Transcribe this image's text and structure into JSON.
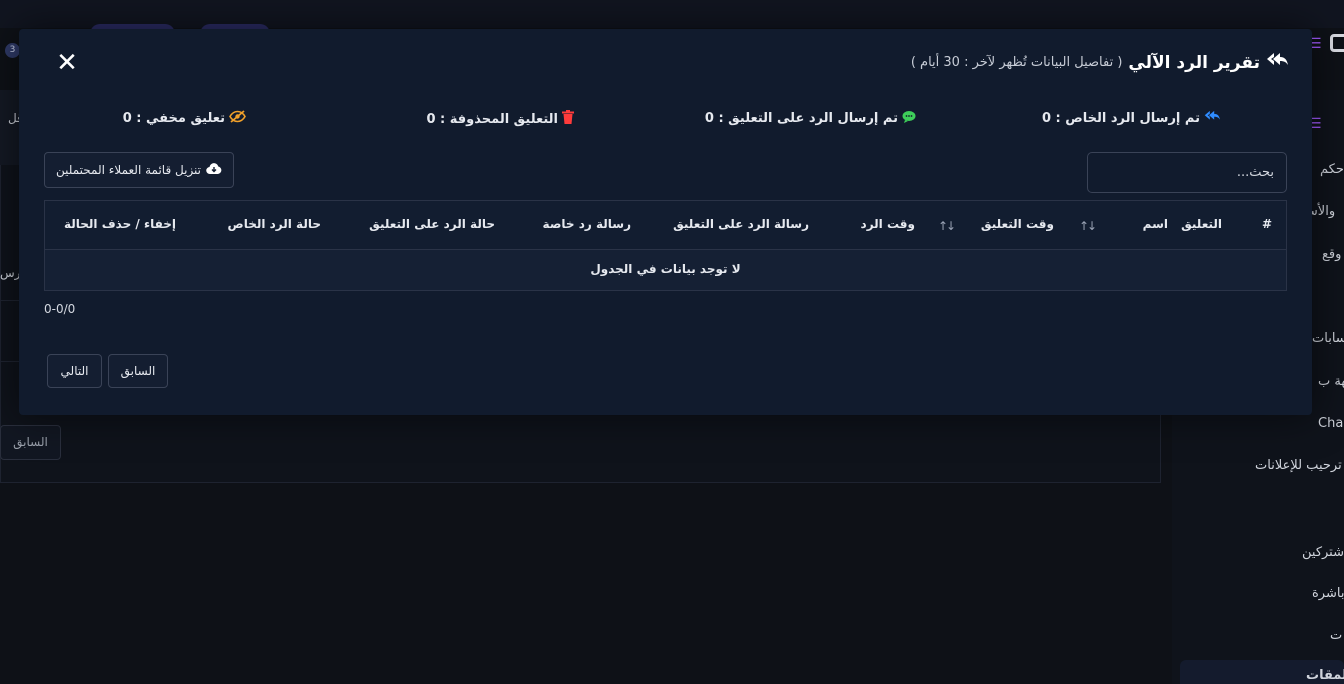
{
  "background": {
    "notifications_count": "3",
    "fragment_left_top": "قل",
    "fragment_left_mid": "رس",
    "prev_label": "السابق",
    "sidebar_items": [
      "حكم",
      "والأسع",
      "وقع",
      "سابات",
      "اجهة ب",
      "Cha",
      "ترحيب للإعلانات",
      "شتركين",
      "باشرة",
      "ت",
      "لمقات"
    ]
  },
  "modal": {
    "title": "تقرير الرد الآلي",
    "subtitle": "( تفاصيل البيانات تُظهر لآخر : 30 أيام )",
    "close_icon": "close-icon",
    "stats": {
      "private_reply_sent": {
        "label": "تم إرسال الرد الخاص : 0",
        "icon": "reply-all-icon",
        "color": "#2f8cff"
      },
      "comment_reply_sent": {
        "label": "تم إرسال الرد على التعليق : 0",
        "icon": "chat-bubble-icon",
        "color": "#3ecf5a"
      },
      "deleted_comment": {
        "label": "التعليق المحذوفة : 0",
        "icon": "trash-icon",
        "color": "#ff3b3b"
      },
      "hidden_comment": {
        "label": "تعليق مخفي : 0",
        "icon": "eye-slash-icon",
        "color": "#f0a02a"
      }
    },
    "download_button": "تنزيل قائمة العملاء المحتملين",
    "search_placeholder": "بحث...",
    "table": {
      "columns": [
        "#",
        "التعليق",
        "اسم",
        "وقت التعليق",
        "وقت الرد",
        "رسالة الرد على التعليق",
        "رسالة رد خاصة",
        "حالة الرد على التعليق",
        "حالة الرد الخاص",
        "إخفاء / حذف الحالة"
      ],
      "empty_message": "لا توجد بيانات في الجدول"
    },
    "pagination": {
      "info": "0-0/0",
      "previous": "السابق",
      "next": "التالي"
    }
  }
}
